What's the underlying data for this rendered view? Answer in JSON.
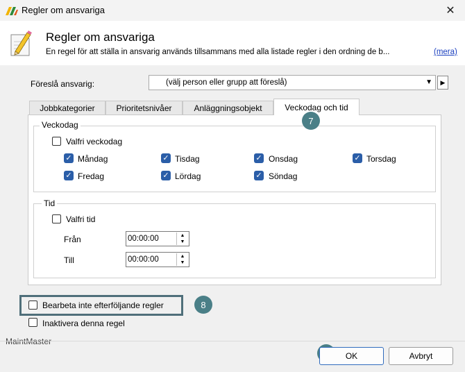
{
  "window": {
    "title": "Regler om ansvariga",
    "close_glyph": "✕"
  },
  "header": {
    "title": "Regler om ansvariga",
    "description": "En regel för att ställa in ansvarig används tillsammans med alla listade regler i den ordning de b...",
    "more_link": "(mera)"
  },
  "suggest": {
    "label": "Föreslå ansvarig:",
    "value": "(välj person eller grupp att föreslå)",
    "arrow": "▼",
    "go": "▶"
  },
  "tabs": [
    {
      "label": "Jobbkategorier"
    },
    {
      "label": "Prioritetsnivåer"
    },
    {
      "label": "Anläggningsobjekt"
    },
    {
      "label": "Veckodag och tid",
      "active": true
    }
  ],
  "weekday_group": {
    "legend": "Veckodag",
    "any_label": "Valfri veckodag",
    "days": [
      {
        "label": "Måndag",
        "checked": true
      },
      {
        "label": "Tisdag",
        "checked": true
      },
      {
        "label": "Onsdag",
        "checked": true
      },
      {
        "label": "Torsdag",
        "checked": true
      },
      {
        "label": "Fredag",
        "checked": true
      },
      {
        "label": "Lördag",
        "checked": true
      },
      {
        "label": "Söndag",
        "checked": true
      }
    ]
  },
  "time_group": {
    "legend": "Tid",
    "any_label": "Valfri tid",
    "from_label": "Från",
    "from_value": "00:00:00",
    "to_label": "Till",
    "to_value": "00:00:00"
  },
  "options": {
    "no_process_label": "Bearbeta inte efterföljande regler",
    "disable_label": "Inaktivera denna regel"
  },
  "badges": {
    "seven": "7",
    "eight": "8",
    "nine": "9"
  },
  "footer": {
    "brand": "MaintMaster",
    "ok_label": "OK",
    "cancel_label": "Avbryt"
  },
  "icons": {
    "app": "app-logo-icon",
    "header": "edit-pencil-icon",
    "check": "✓"
  },
  "colors": {
    "accent": "#2b5ea8",
    "badge": "#4a7f87",
    "link": "#1a3fbf"
  }
}
